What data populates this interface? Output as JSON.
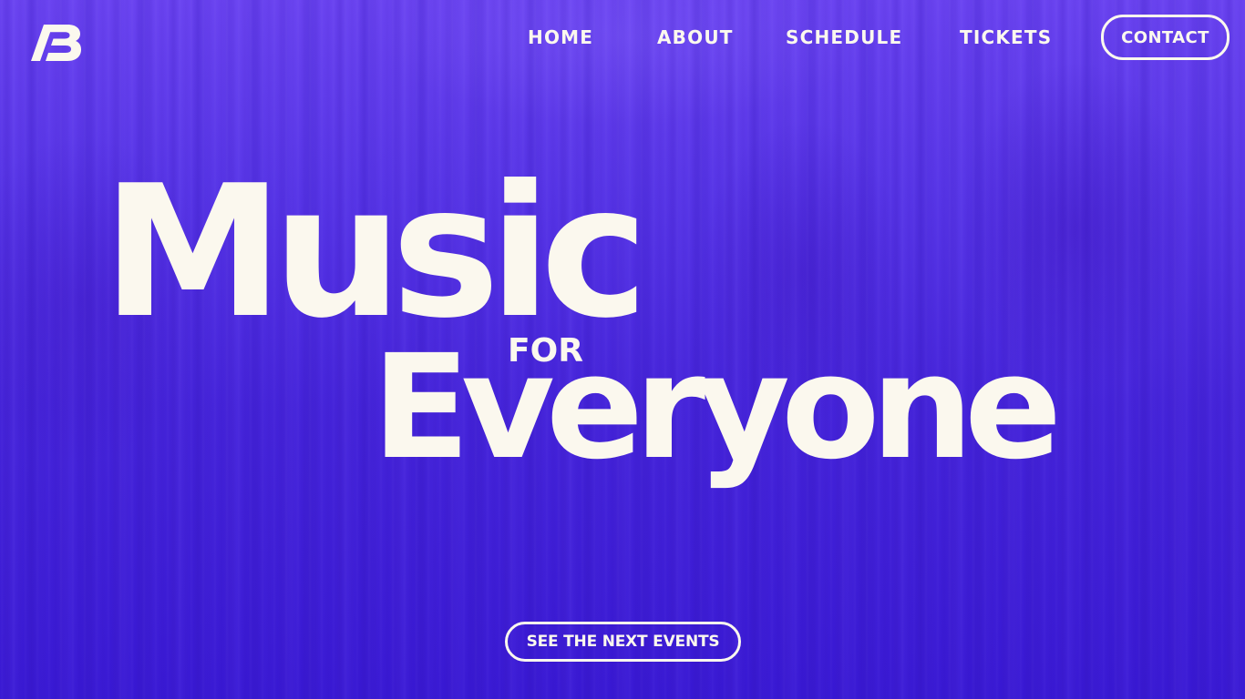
{
  "brand": {
    "logo_text": "/B",
    "icon": "ab-monogram-logo"
  },
  "nav": {
    "items": [
      {
        "label": "HOME"
      },
      {
        "label": "ABOUT"
      },
      {
        "label": "SCHEDULE"
      },
      {
        "label": "TICKETS"
      }
    ],
    "contact_label": "CONTACT"
  },
  "hero": {
    "line1": "Music",
    "connector": "FOR",
    "line2": "Everyone",
    "cta_label": "SEE THE NEXT EVENTS"
  },
  "colors": {
    "background_top": "#6a43f0",
    "background_bottom": "#3818d3",
    "text": "#fbf8ee"
  }
}
